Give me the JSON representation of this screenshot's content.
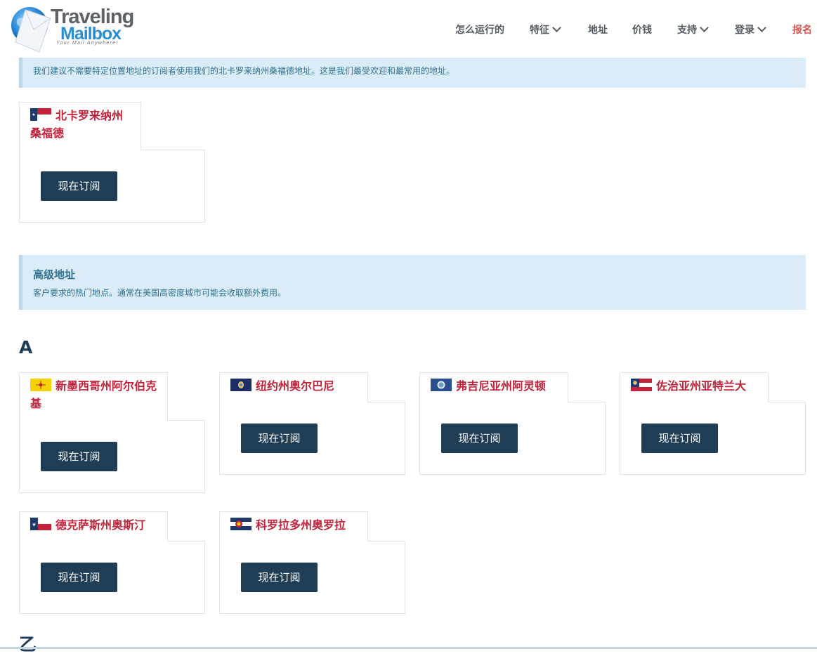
{
  "brand": {
    "name_line1": "Traveling",
    "name_line2": "Mailbox",
    "tagline": "Your Mail Anywhere!"
  },
  "nav": {
    "items": [
      {
        "label": "怎么运行的",
        "dropdown": false
      },
      {
        "label": "特征",
        "dropdown": true
      },
      {
        "label": "地址",
        "dropdown": false
      },
      {
        "label": "价钱",
        "dropdown": false
      },
      {
        "label": "支持",
        "dropdown": true
      },
      {
        "label": "登录",
        "dropdown": true
      },
      {
        "label": "报名",
        "dropdown": false,
        "accent": "#d9534f"
      }
    ]
  },
  "recommend_note": "我们建议不需要特定位置地址的订阅者使用我们的北卡罗来纳州桑福德地址。这是我们最受欢迎和最常用的地址。",
  "featured": {
    "name": "北卡罗来纳州桑福德",
    "flag": "north-carolina-flag",
    "button": "现在订阅"
  },
  "premium": {
    "heading": "高级地址",
    "description": "客户要求的热门地点。通常在美国高密度城市可能会收取额外费用。"
  },
  "sections": [
    {
      "letter": "A",
      "locations": [
        {
          "name": "新墨西哥州阿尔伯克基",
          "flag": "new-mexico-flag",
          "button": "现在订阅"
        },
        {
          "name": "纽约州奥尔巴尼",
          "flag": "new-york-flag",
          "button": "现在订阅"
        },
        {
          "name": "弗吉尼亚州阿灵顿",
          "flag": "virginia-flag",
          "button": "现在订阅"
        },
        {
          "name": "佐治亚州亚特兰大",
          "flag": "georgia-flag",
          "button": "现在订阅"
        },
        {
          "name": "德克萨斯州奥斯汀",
          "flag": "texas-flag",
          "button": "现在订阅"
        },
        {
          "name": "科罗拉多州奥罗拉",
          "flag": "colorado-flag",
          "button": "现在订阅"
        }
      ]
    },
    {
      "letter": "乙"
    }
  ],
  "colors": {
    "accent_red": "#c0233a",
    "button_navy": "#1f3d55",
    "info_bg": "#d9ecf7",
    "info_text": "#31708f"
  }
}
